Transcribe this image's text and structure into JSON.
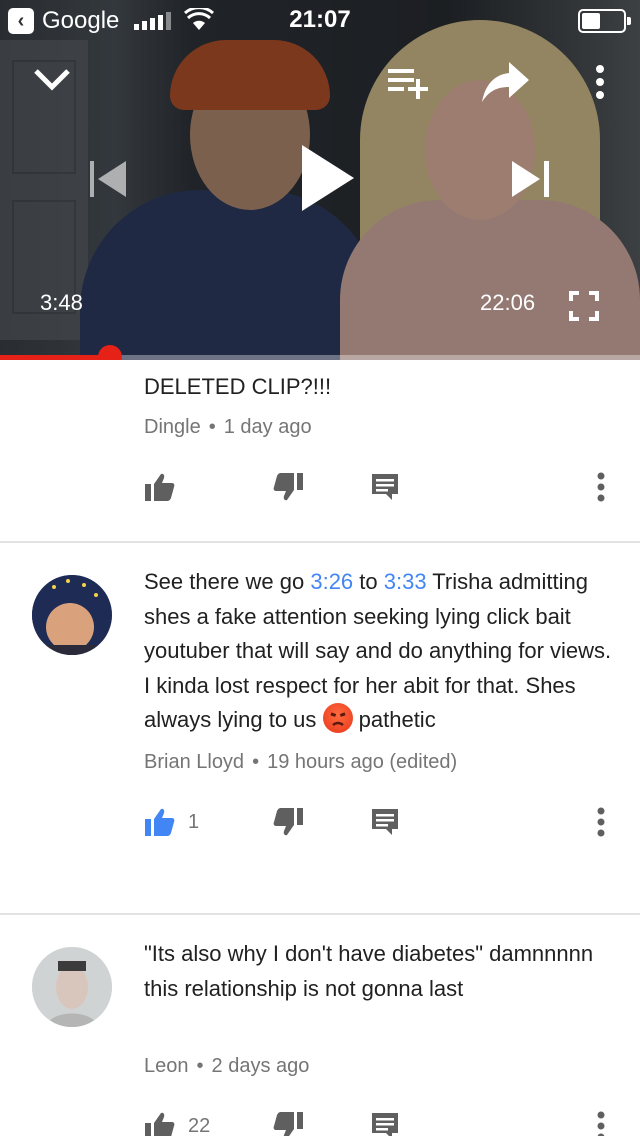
{
  "status_bar": {
    "back_app": "Google",
    "time": "21:07"
  },
  "player": {
    "elapsed": "3:48",
    "duration": "22:06",
    "progress": 0.172
  },
  "comments": [
    {
      "text_clipped": "out out. like WHAT WAS SAID IN THAT DELETED CLIP?!!!",
      "text_visible": "DELETED CLIP?!!!",
      "author": "Dingle",
      "age": "1 day ago",
      "likes": ""
    },
    {
      "parts": [
        "See there we go ",
        "3:26",
        " to ",
        "3:33",
        " Trisha admitting shes a fake attention seeking lying click bait youtuber that will say and do anything for views. I kinda lost respect for her abit for that. Shes always lying to us ",
        " pathetic"
      ],
      "author": "Brian Lloyd",
      "age": "19 hours ago (edited)",
      "likes": "1"
    },
    {
      "text": "\"Its also why I don't have diabetes\" damnnnnn this relationship is not gonna last",
      "author": "Leon",
      "age": "2 days ago",
      "likes": "22"
    }
  ],
  "colors": {
    "accent_red": "#e62117",
    "link_blue": "#4285f4",
    "meta_gray": "#757575",
    "icon_gray": "#5f5f5f"
  }
}
